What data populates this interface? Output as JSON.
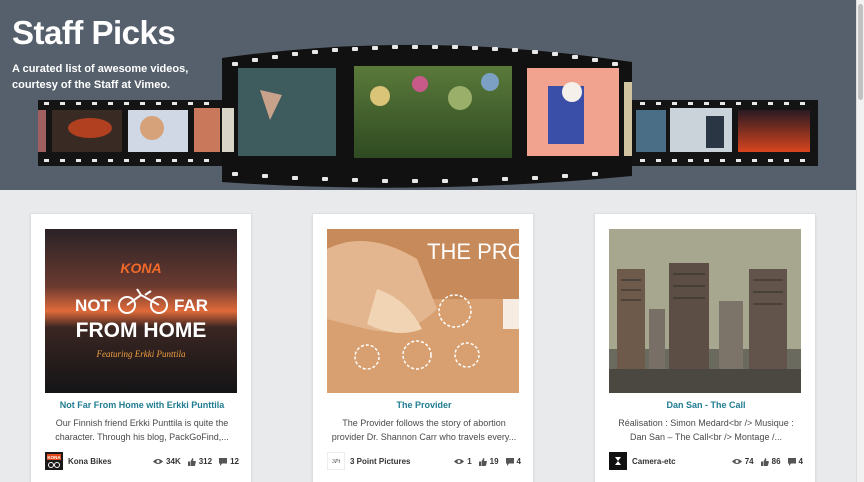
{
  "hero": {
    "title": "Staff Picks",
    "subtitle": "A curated list of awesome videos, courtesy of the Staff at Vimeo."
  },
  "cards": [
    {
      "title": "Not Far From Home with Erkki Punttila",
      "description": "Our Finnish friend Erkki Punttila is quite the character. Through his blog, PackGoFind,...",
      "owner": "Kona Bikes",
      "views": "34K",
      "likes": "312",
      "comments": "12",
      "thumb_brand": "KONA",
      "thumb_line1": "NOT",
      "thumb_line1b": "FAR",
      "thumb_line2": "FROM HOME",
      "thumb_caption": "Featuring Erkki Punttila",
      "avatar_text": "KONA"
    },
    {
      "title": "The Provider",
      "description": "The Provider follows the story of abortion provider Dr. Shannon Carr who travels every...",
      "owner": "3 Point Pictures",
      "views": "1",
      "likes": "19",
      "comments": "4",
      "thumb_title": "THE PROV",
      "avatar_text": "3Pt"
    },
    {
      "title": "Dan San - The Call",
      "description": "Réalisation : Simon Medard<br /> Musique : Dan San – The Call<br /> Montage /...",
      "owner": "Camera-etc",
      "views": "74",
      "likes": "86",
      "comments": "4"
    }
  ],
  "colors": {
    "hero_bg": "#56606c",
    "title_link": "#1f7c91",
    "page_bg": "#e8eaec"
  },
  "icons": [
    "eye-icon",
    "thumbs-up-icon",
    "comment-icon"
  ]
}
